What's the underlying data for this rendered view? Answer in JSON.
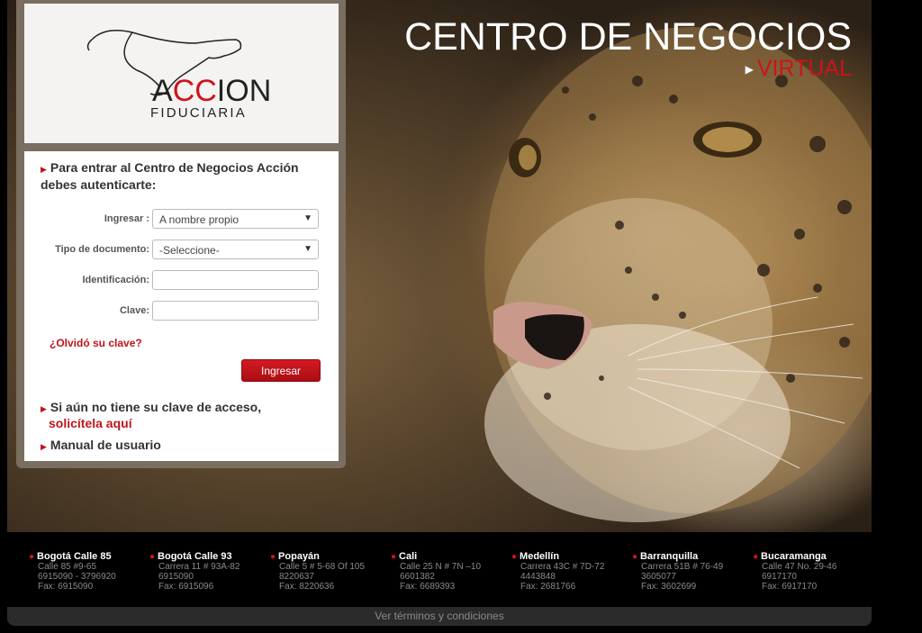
{
  "brand": {
    "logo_main": "ACCION",
    "logo_sub": "FIDUCIARIA",
    "colors": {
      "accent": "#d0121b",
      "panel": "#7a6e60"
    }
  },
  "headline": {
    "title": "CENTRO DE NEGOCIOS",
    "subtitle": "VIRTUAL"
  },
  "form": {
    "intro": "Para entrar al Centro de Negocios Acción debes autenticarte:",
    "ingresar_label": "Ingresar :",
    "ingresar_value": "A nombre propio",
    "tipo_label": "Tipo de documento:",
    "tipo_value": "-Seleccione-",
    "identificacion_label": "Identificación:",
    "identificacion_value": "",
    "clave_label": "Clave:",
    "clave_value": "",
    "forgot": "¿Olvidó su clave?",
    "submit": "Ingresar",
    "no_key_text": "Si aún no tiene su clave de acceso,",
    "no_key_link": "solicítela aquí",
    "manual": "Manual de usuario"
  },
  "offices": [
    {
      "name": "Bogotá Calle 85",
      "lines": [
        "Calle 85 #9-65",
        "6915090 - 3796920",
        "Fax: 6915090"
      ]
    },
    {
      "name": "Bogotá Calle 93",
      "lines": [
        "Carrera 11 # 93A-82",
        "6915090",
        "Fax: 6915096"
      ]
    },
    {
      "name": "Popayán",
      "lines": [
        "Calle 5 # 5-68 Of 105",
        "8220637",
        "Fax: 8220636"
      ]
    },
    {
      "name": "Cali",
      "lines": [
        "Calle 25 N # 7N –10",
        "6601382",
        "Fax: 6689393"
      ]
    },
    {
      "name": "Medellín",
      "lines": [
        "Carrera 43C # 7D-72",
        "4443848",
        "Fax: 2681766"
      ]
    },
    {
      "name": "Barranquilla",
      "lines": [
        "Carrera 51B # 76-49",
        "3605077",
        "Fax: 3602699"
      ]
    },
    {
      "name": "Bucaramanga",
      "lines": [
        "Calle 47 No. 29-46",
        "6917170",
        "Fax: 6917170"
      ]
    }
  ],
  "footer": {
    "terms": "Ver términos y condiciones"
  }
}
